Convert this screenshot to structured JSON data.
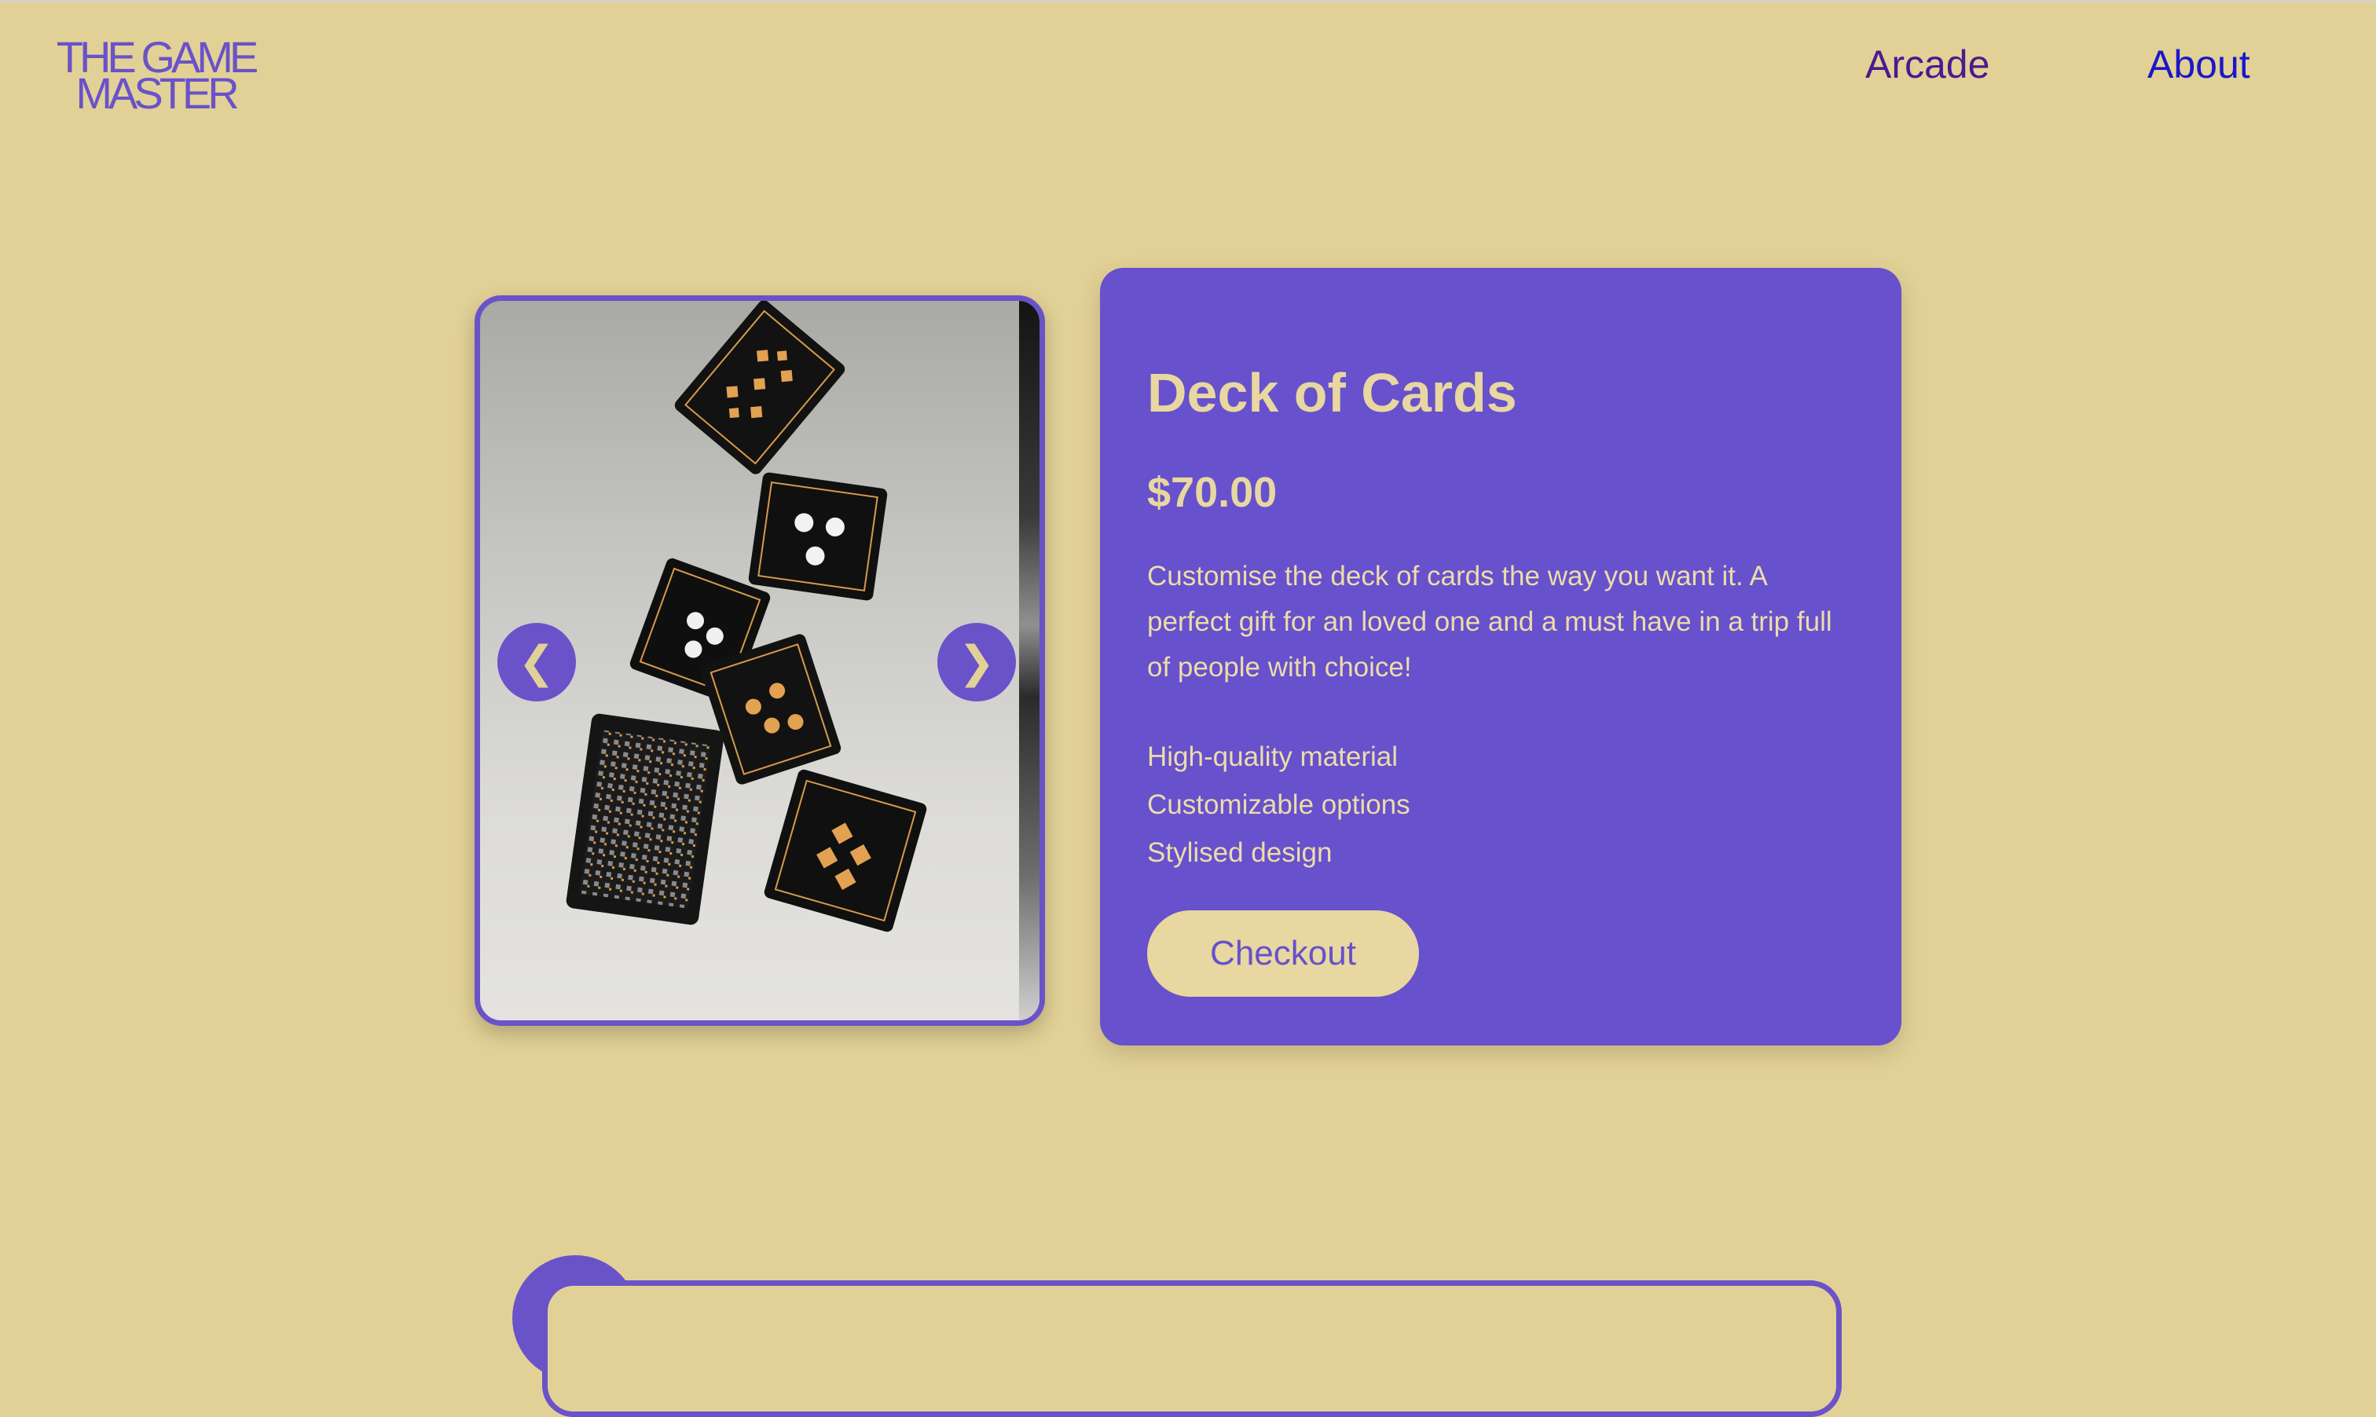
{
  "header": {
    "logo_line1": "THE GAME",
    "logo_line2": "MASTER",
    "nav": {
      "arcade": "Arcade",
      "about": "About"
    }
  },
  "carousel": {
    "prev_label": "❮",
    "next_label": "❯"
  },
  "product": {
    "title": "Deck of Cards",
    "price": "$70.00",
    "description": "Customise the deck of cards the way you want it. A perfect gift for an loved one and a must have in a trip full of people with choice!",
    "features": [
      "High-quality material",
      "Customizable options",
      "Stylised design"
    ],
    "checkout_label": "Checkout"
  },
  "colors": {
    "background": "#e2d196",
    "accent": "#6a52c9",
    "card_background": "#6751cc",
    "card_text": "#e8d7a0",
    "nav_arcade": "#4b1a8f",
    "nav_about": "#1a17c9"
  }
}
